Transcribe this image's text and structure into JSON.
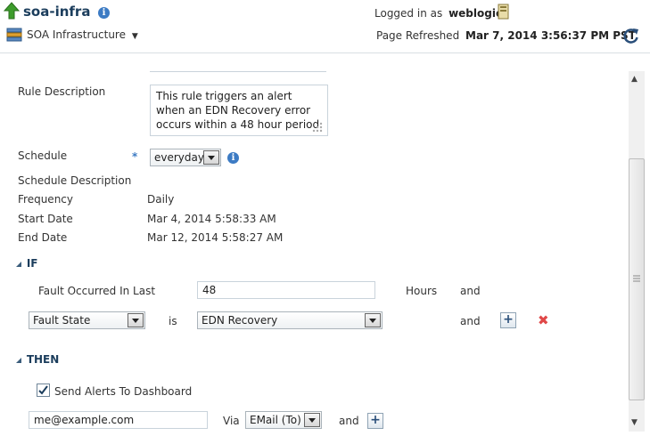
{
  "header": {
    "title": "soa-infra",
    "menu_label": "SOA Infrastructure",
    "logged_in_label": "Logged in as",
    "user": "weblogic",
    "refreshed_label": "Page Refreshed",
    "refreshed_value": "Mar 7, 2014 3:56:37 PM PST"
  },
  "rule": {
    "description_label": "Rule Description",
    "description_value": "This rule triggers an alert when an EDN Recovery error occurs within a 48 hour period",
    "schedule_label": "Schedule",
    "required_marker": "*",
    "schedule_value": "everyday",
    "schedule_description_label": "Schedule Description",
    "frequency_label": "Frequency",
    "frequency_value": "Daily",
    "start_label": "Start Date",
    "start_value": "Mar 4, 2014 5:58:33 AM",
    "end_label": "End Date",
    "end_value": "Mar 12, 2014 5:58:27 AM"
  },
  "if_section": {
    "title": "IF",
    "fault_occurred_label": "Fault Occurred In Last",
    "fault_occurred_value": "48",
    "hours_label": "Hours",
    "and_label": "and",
    "condition_field": "Fault State",
    "is_label": "is",
    "condition_value": "EDN Recovery"
  },
  "then_section": {
    "title": "THEN",
    "send_alerts_label": "Send Alerts To Dashboard",
    "send_alerts_checked": true,
    "email_value": "me@example.com",
    "via_label": "Via",
    "via_value": "EMail (To)",
    "and_label": "and"
  },
  "icons": {
    "up-arrow": "up-arrow-icon",
    "info": "info-icon",
    "refresh": "refresh-icon",
    "plus": "+",
    "delete": "✖"
  },
  "colors": {
    "accent": "#1b3d5c",
    "info": "#3c7bc4",
    "delete": "#e04848",
    "green": "#3d9c2b"
  }
}
